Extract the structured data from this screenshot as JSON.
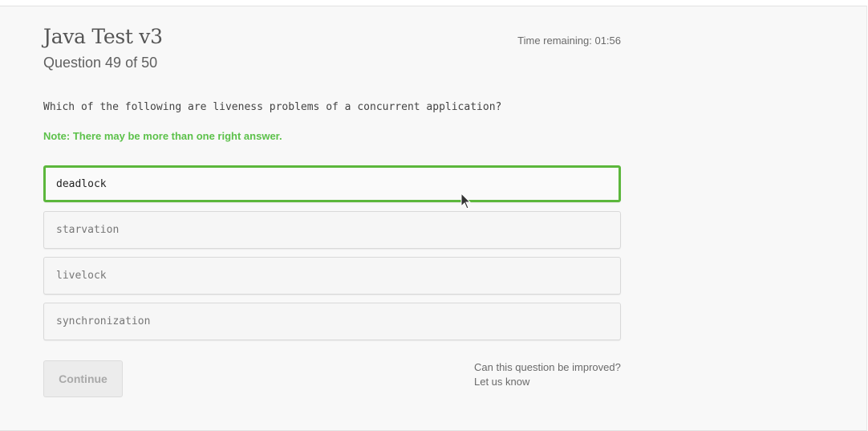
{
  "quiz": {
    "title": "Java Test v3",
    "progress": "Question 49 of 50",
    "timer": "Time remaining: 01:56"
  },
  "question": {
    "text": "Which of the following are liveness problems of a concurrent application?",
    "note": "Note: There may be more than one right answer."
  },
  "options": [
    {
      "label": "deadlock",
      "selected": true
    },
    {
      "label": "starvation",
      "selected": false
    },
    {
      "label": "livelock",
      "selected": false
    },
    {
      "label": "synchronization",
      "selected": false
    }
  ],
  "footer": {
    "continue_label": "Continue",
    "continue_enabled": false,
    "improve_text": "Can this question be improved?",
    "improve_link": "Let us know"
  },
  "colors": {
    "accent_green": "#5cb73c",
    "note_green": "#5cc14a"
  },
  "icons": {
    "cursor": "mouse-pointer-icon"
  }
}
